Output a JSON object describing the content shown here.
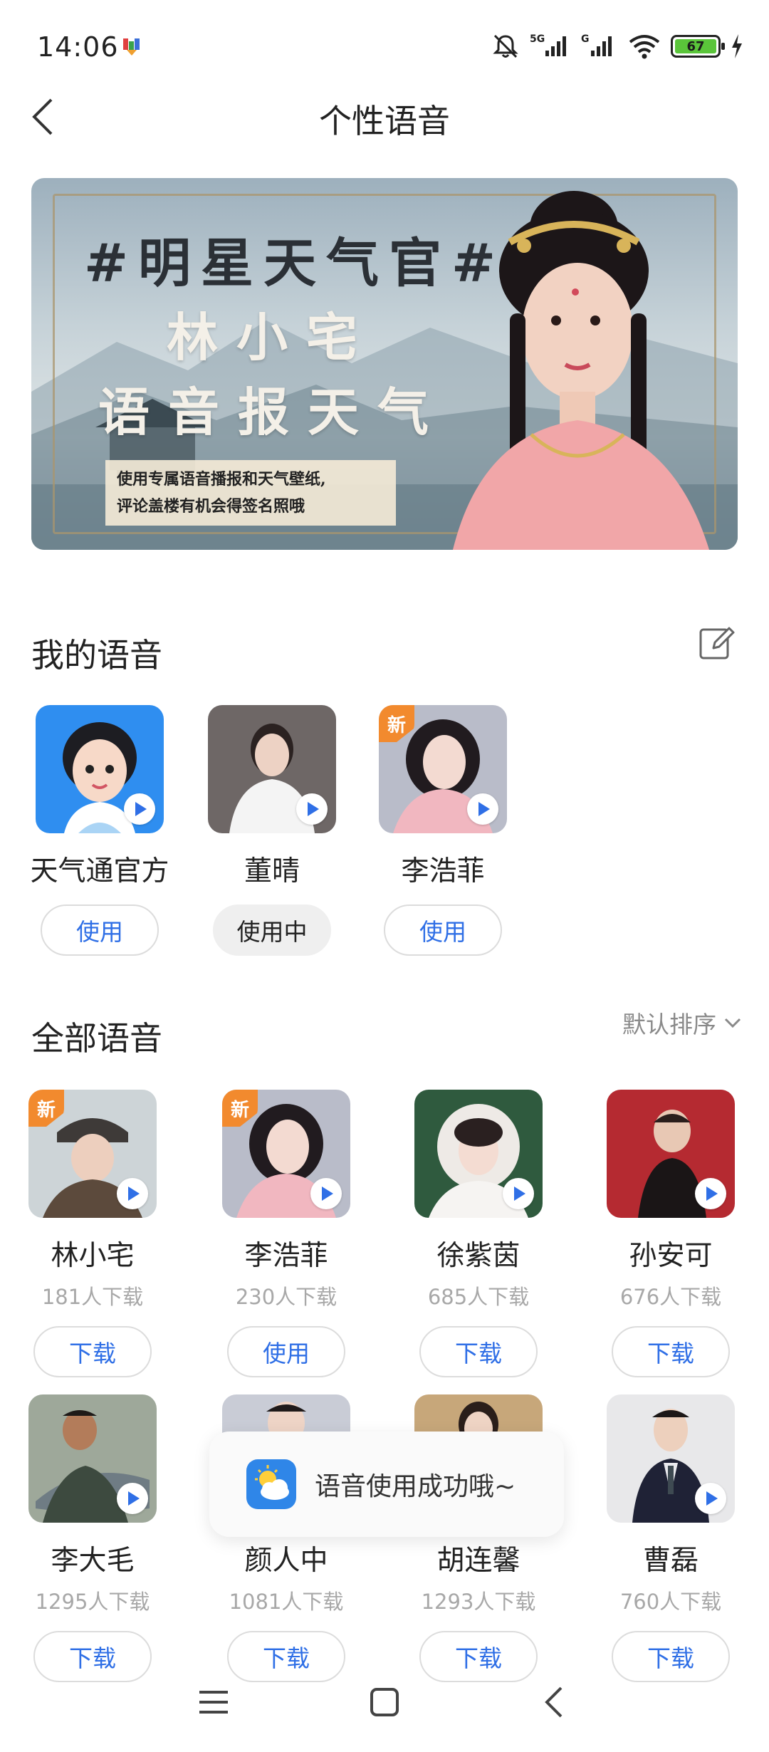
{
  "status_bar": {
    "time": "14:06",
    "battery": "67",
    "signal1": "5G",
    "signal2": "G"
  },
  "header": {
    "title": "个性语音"
  },
  "banner": {
    "title": "#明星天气官#",
    "line1": "林小宅",
    "line2": "语音报天气",
    "note_line1": "使用专属语音播报和天气壁纸,",
    "note_line2": "评论盖楼有机会得签名照哦"
  },
  "my_voices": {
    "title": "我的语音",
    "items": [
      {
        "name": "天气通官方",
        "button": "使用",
        "is_new": false,
        "in_use": false
      },
      {
        "name": "董晴",
        "button": "使用中",
        "is_new": false,
        "in_use": true
      },
      {
        "name": "李浩菲",
        "button": "使用",
        "is_new": true,
        "in_use": false
      }
    ]
  },
  "all_voices": {
    "title": "全部语音",
    "sort_label": "默认排序",
    "new_badge": "新",
    "items": [
      {
        "name": "林小宅",
        "downloads": "181人下载",
        "button": "下载",
        "is_new": true
      },
      {
        "name": "李浩菲",
        "downloads": "230人下载",
        "button": "使用",
        "is_new": true
      },
      {
        "name": "徐紫茵",
        "downloads": "685人下载",
        "button": "下载",
        "is_new": false
      },
      {
        "name": "孙安可",
        "downloads": "676人下载",
        "button": "下载",
        "is_new": false
      },
      {
        "name": "李大毛",
        "downloads": "1295人下载",
        "button": "下载",
        "is_new": false
      },
      {
        "name": "颜人中",
        "downloads": "1081人下载",
        "button": "下载",
        "is_new": false
      },
      {
        "name": "胡连馨",
        "downloads": "1293人下载",
        "button": "下载",
        "is_new": false
      },
      {
        "name": "曹磊",
        "downloads": "760人下载",
        "button": "下载",
        "is_new": false
      }
    ]
  },
  "toast": {
    "text": "语音使用成功哦~"
  },
  "colors": {
    "accent": "#2f6fe6",
    "badge": "#f28a2e",
    "battery": "#5ac53a"
  }
}
